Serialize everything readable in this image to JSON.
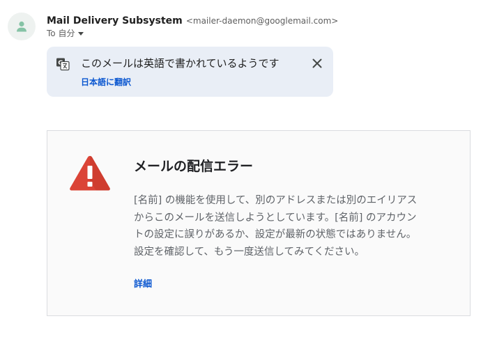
{
  "sender": {
    "name": "Mail Delivery Subsystem",
    "email": "<mailer-daemon@googlemail.com>",
    "to_label": "To 自分"
  },
  "translate_banner": {
    "message": "このメールは英語で書かれているようです",
    "action_label": "日本語に翻訳"
  },
  "error_card": {
    "title": "メールの配信エラー",
    "body_lines": [
      "[名前] の機能を使用して、別のアドレスまたは別のエイリアス",
      "からこのメールを送信しようとしています。[名前] のアカウン",
      "トの設定に誤りがあるか、設定が最新の状態ではありません。",
      "設定を確認して、もう一度送信してみてください。"
    ],
    "details_label": "詳細"
  },
  "icons": {
    "avatar": "person-icon",
    "translate": "translate-icon",
    "close": "close-icon",
    "warning": "warning-icon",
    "caret": "caret-down-icon"
  },
  "colors": {
    "link": "#0b57d0",
    "banner_bg": "#e9eef6",
    "avatar_accent": "#86c3a6",
    "warning_red": "#db4437",
    "card_bg": "#fafafa"
  }
}
